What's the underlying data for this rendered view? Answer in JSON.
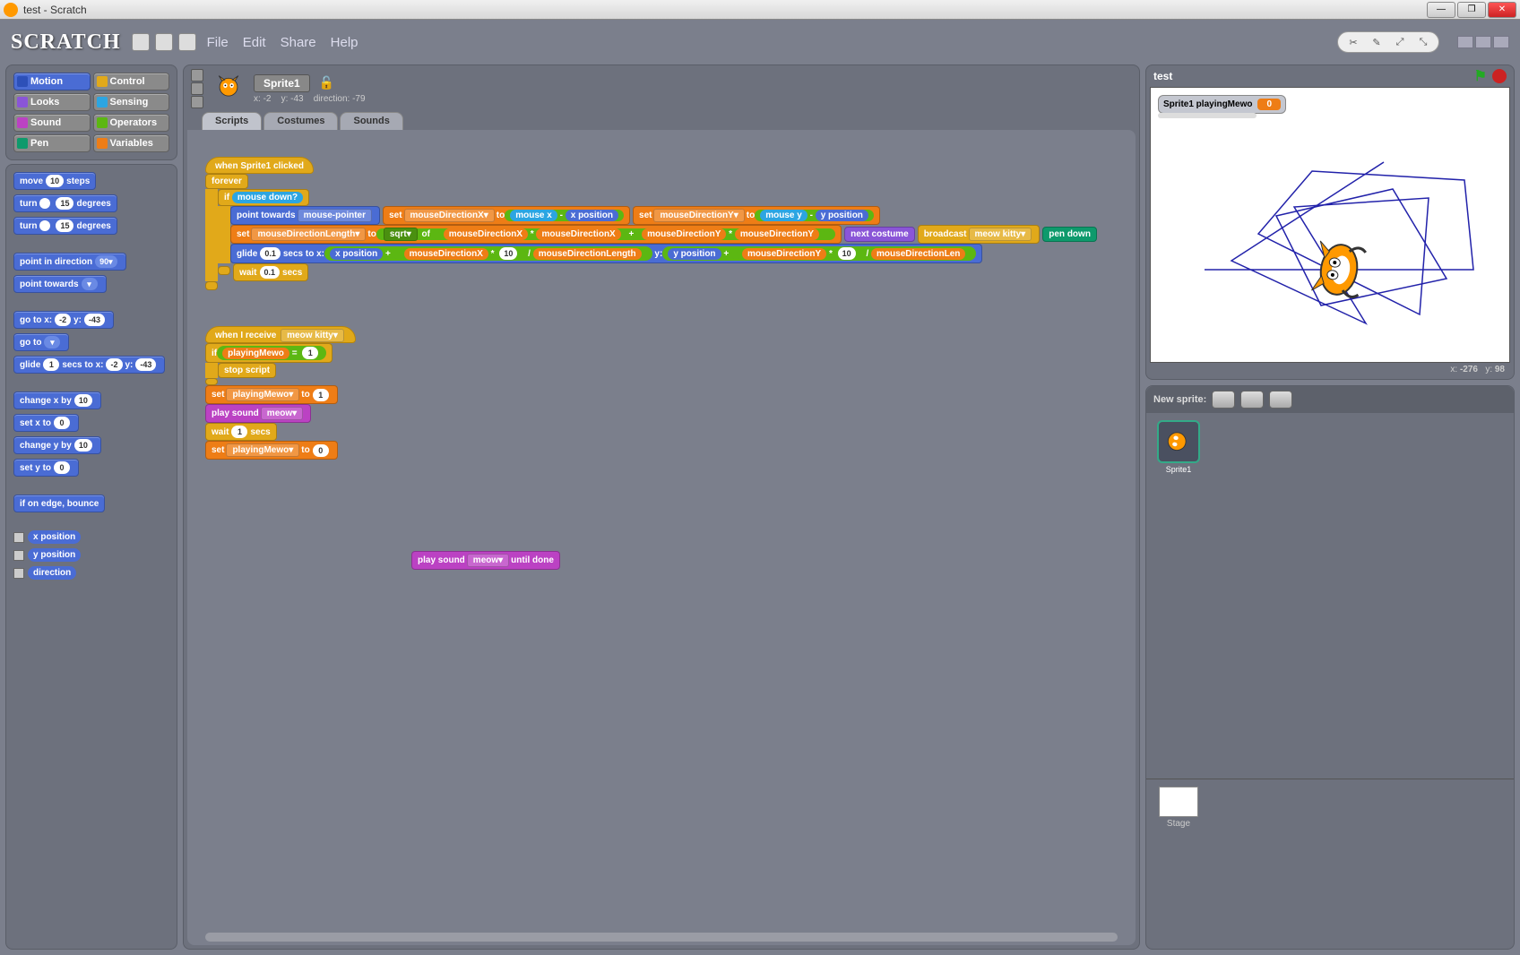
{
  "window": {
    "title": "test - Scratch"
  },
  "logo": "SCRATCH",
  "menus": [
    "File",
    "Edit",
    "Share",
    "Help"
  ],
  "categories": [
    {
      "name": "Motion",
      "cls": "cat-motion"
    },
    {
      "name": "Control",
      "cls": "cat-control"
    },
    {
      "name": "Looks",
      "cls": "cat-looks"
    },
    {
      "name": "Sensing",
      "cls": "cat-sensing"
    },
    {
      "name": "Sound",
      "cls": "cat-sound"
    },
    {
      "name": "Operators",
      "cls": "cat-operators"
    },
    {
      "name": "Pen",
      "cls": "cat-pen"
    },
    {
      "name": "Variables",
      "cls": "cat-variables"
    }
  ],
  "palette": {
    "move_steps": {
      "pre": "move",
      "val": "10",
      "post": "steps"
    },
    "turn_cw": {
      "pre": "turn",
      "val": "15",
      "post": "degrees"
    },
    "turn_ccw": {
      "pre": "turn",
      "val": "15",
      "post": "degrees"
    },
    "point_dir": {
      "pre": "point in direction",
      "val": "90▾"
    },
    "point_towards": {
      "pre": "point towards",
      "val": "▾"
    },
    "goto_xy": {
      "pre": "go to x:",
      "x": "-2",
      "mid": "y:",
      "y": "-43"
    },
    "goto": {
      "pre": "go to",
      "val": "▾"
    },
    "glide": {
      "pre": "glide",
      "secs": "1",
      "mid": "secs to x:",
      "x": "-2",
      "mid2": "y:",
      "y": "-43"
    },
    "change_x": {
      "pre": "change x by",
      "val": "10"
    },
    "set_x": {
      "pre": "set x to",
      "val": "0"
    },
    "change_y": {
      "pre": "change y by",
      "val": "10"
    },
    "set_y": {
      "pre": "set y to",
      "val": "0"
    },
    "bounce": "if on edge, bounce",
    "xpos": "x position",
    "ypos": "y position",
    "dir": "direction"
  },
  "sprite": {
    "name": "Sprite1",
    "x": "-2",
    "y": "-43",
    "direction": "-79"
  },
  "sprite_stats_labels": {
    "x": "x:",
    "y": "y:",
    "dir": "direction:"
  },
  "tabs": [
    "Scripts",
    "Costumes",
    "Sounds"
  ],
  "script1": {
    "hat": "when Sprite1 clicked",
    "forever": "forever",
    "if": "if",
    "mouse_down": "mouse down?",
    "point_towards": "point towards",
    "mouse_pointer": "mouse-pointer",
    "set": "set",
    "to": "to",
    "mdx": "mouseDirectionX▾",
    "mdy": "mouseDirectionY▾",
    "mdl": "mouseDirectionLength▾",
    "mouse_x": "mouse x",
    "mouse_y": "mouse y",
    "x_pos": "x position",
    "y_pos": "y position",
    "minus": "-",
    "times": "*",
    "plus": "+",
    "div": "/",
    "sqrt": "sqrt▾",
    "of": "of",
    "mdx_r": "mouseDirectionX",
    "mdy_r": "mouseDirectionY",
    "mdl_r": "mouseDirectionLength",
    "next_costume": "next costume",
    "broadcast": "broadcast",
    "meow_kitty": "meow kitty▾",
    "pen_down": "pen down",
    "glide": "glide",
    "glide_secs": "0.1",
    "secs_to_x": "secs to x:",
    "y_colon": "y:",
    "ten": "10",
    "wait": "wait",
    "wait_secs": "0.1",
    "secs": "secs"
  },
  "script2": {
    "hat": "when I receive",
    "meow_kitty": "meow kitty▾",
    "if": "if",
    "playingMewo": "playingMewo",
    "eq": "=",
    "one": "1",
    "stop_script": "stop script",
    "set": "set",
    "playingMewo_dd": "playingMewo▾",
    "to": "to",
    "play_sound": "play sound",
    "meow": "meow▾",
    "wait": "wait",
    "wait1": "1",
    "secs": "secs",
    "zero": "0"
  },
  "orphan": {
    "play_sound": "play sound",
    "meow": "meow▾",
    "until_done": "until done"
  },
  "stage": {
    "title": "test",
    "var_label": "Sprite1 playingMewo",
    "var_value": "0",
    "coords_x_lbl": "x:",
    "coords_x": "-276",
    "coords_y_lbl": "y:",
    "coords_y": "98"
  },
  "new_sprite": "New sprite:",
  "spritelist": {
    "name": "Sprite1"
  },
  "stage_label": "Stage"
}
